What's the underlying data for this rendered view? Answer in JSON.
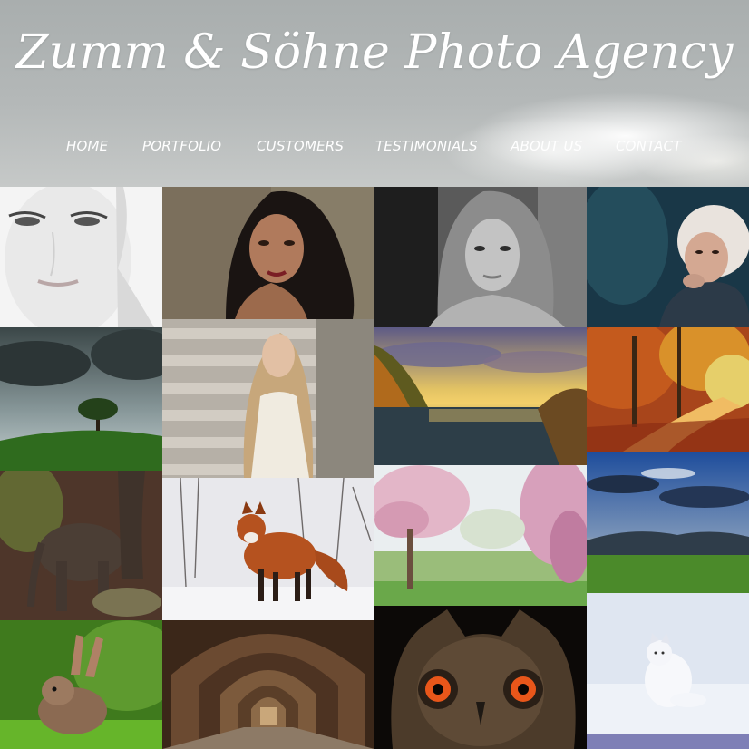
{
  "site": {
    "title": "Zumm & Söhne Photo Agency"
  },
  "nav": {
    "items": [
      {
        "label": "HOME"
      },
      {
        "label": "PORTFOLIO"
      },
      {
        "label": "CUSTOMERS"
      },
      {
        "label": "TESTIMONIALS"
      },
      {
        "label": "ABOUT US"
      },
      {
        "label": "CONTACT"
      }
    ]
  },
  "gallery": {
    "photos": [
      {
        "subject": "woman-face-high-key"
      },
      {
        "subject": "woman-dark-hair-portrait"
      },
      {
        "subject": "woman-black-and-white-portrait"
      },
      {
        "subject": "woman-fur-hood-winter"
      },
      {
        "subject": "lone-tree-on-hill-storm"
      },
      {
        "subject": "blonde-woman-on-steps"
      },
      {
        "subject": "lake-sunset-autumn"
      },
      {
        "subject": "autumn-forest-path"
      },
      {
        "subject": "baby-elephant"
      },
      {
        "subject": "red-fox-in-snow"
      },
      {
        "subject": "pink-blossom-trees"
      },
      {
        "subject": "dramatic-sky-over-meadow"
      },
      {
        "subject": "rabbit-in-grass"
      },
      {
        "subject": "brick-arch-tunnel"
      },
      {
        "subject": "owl-orange-eyes"
      },
      {
        "subject": "arctic-fox-in-snow"
      }
    ]
  },
  "colors": {
    "header_sky": "#b1b5b5",
    "nav_text": "#ffffff",
    "title_text": "#ffffff"
  }
}
